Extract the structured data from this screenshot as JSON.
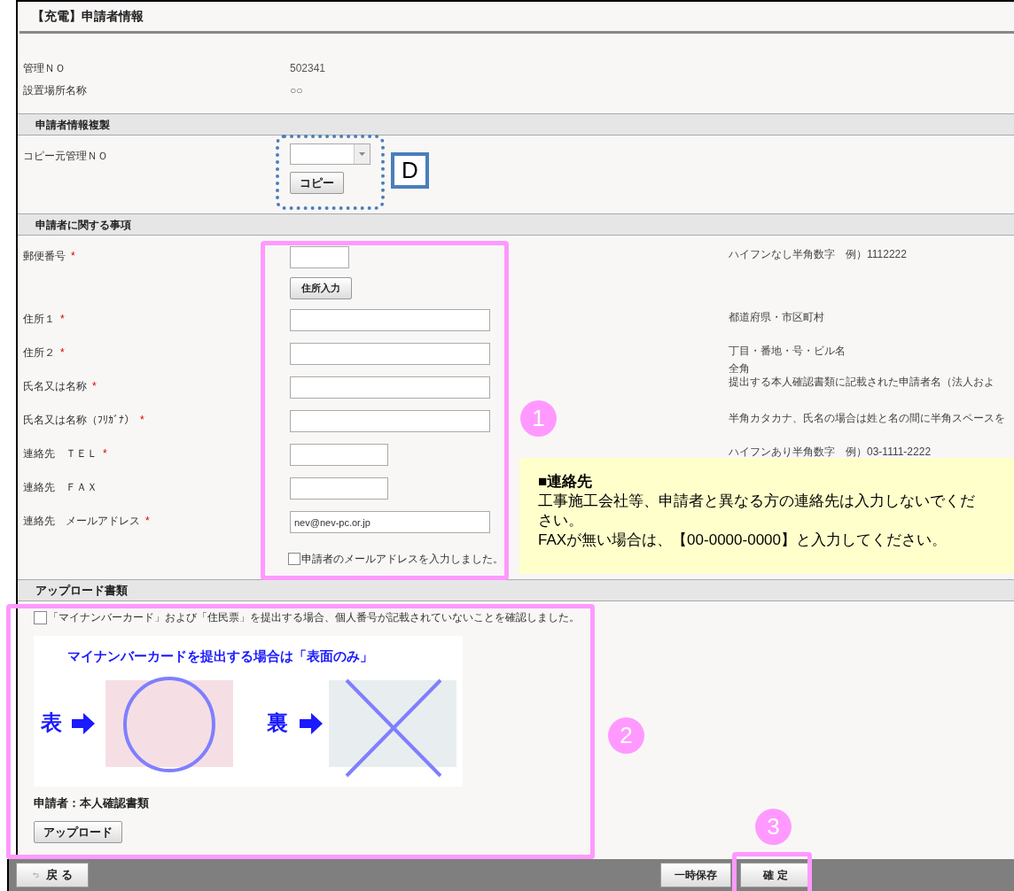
{
  "title": "【充電】申請者情報",
  "info": [
    {
      "label": "管理ＮＯ",
      "value": "502341"
    },
    {
      "label": "設置場所名称",
      "value": "○○"
    }
  ],
  "copy_section": {
    "heading": "申請者情報複製",
    "label": "コピー元管理ＮＯ",
    "button": "コピー"
  },
  "applicant_section": {
    "heading": "申請者に関する事項",
    "fields": [
      {
        "kind": "zip",
        "label": "郵便番号",
        "required": "*",
        "button": "住所入力",
        "hint": [
          "ハイフンなし半角数字　例）1112222"
        ]
      },
      {
        "kind": "long",
        "label": "住所１",
        "required": "*",
        "hint": [
          "都道府県・市区町村"
        ]
      },
      {
        "kind": "long",
        "label": "住所２",
        "required": "*",
        "hint": [
          "丁目・番地・号・ビル名"
        ]
      },
      {
        "kind": "long",
        "label": "氏名又は名称",
        "required": "*",
        "hint": [
          "全角",
          "提出する本人確認書類に記載された申請者名（法人およ"
        ]
      },
      {
        "kind": "long",
        "label": "氏名又は名称（ﾌﾘｶﾞﾅ）",
        "required": "*",
        "hint": [
          "半角カタカナ、氏名の場合は姓と名の間に半角スペースを"
        ]
      },
      {
        "kind": "medium",
        "label": "連絡先　ＴＥＬ",
        "required": "*",
        "hint": [
          "ハイフンあり半角数字　例）03-1111-2222"
        ]
      },
      {
        "kind": "medium",
        "label": "連絡先　ＦＡＸ"
      },
      {
        "kind": "long",
        "label": "連絡先　メールアドレス",
        "required": "*",
        "value": "nev@nev-pc.or.jp"
      }
    ],
    "confirm": {
      "label": "申請者のメールアドレスを入力しました。",
      "checked": false
    }
  },
  "upload_section": {
    "heading": "アップロード書類",
    "confirm": {
      "label": "「マイナンバーカード」および「住民票」を提出する場合、個人番号が記載されていないことを確認しました。",
      "checked": false
    },
    "illustration": {
      "heading": "マイナンバーカードを提出する場合は「表面のみ」",
      "front": "表",
      "back": "裏"
    },
    "document": "申請者：本人確認書類",
    "button": "アップロード"
  },
  "footer": {
    "back": "戻 る",
    "save": "一時保存",
    "confirm": "確 定"
  },
  "note": {
    "heading": "■連絡先",
    "lines": [
      "工事施工会社等、申請者と異なる方の連絡先は入力しないでください。",
      "FAXが無い場合は、【00-0000-0000】と入力してください。"
    ]
  },
  "callouts": [
    {
      "number": "1"
    },
    {
      "number": "2"
    },
    {
      "number": "3"
    }
  ],
  "marker": "D"
}
